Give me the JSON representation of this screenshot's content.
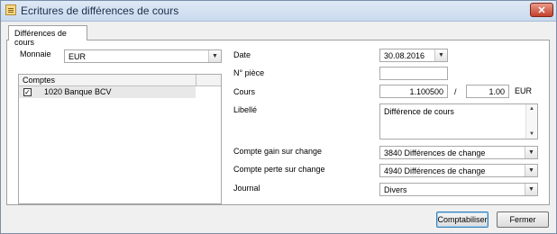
{
  "window": {
    "title": "Ecritures de différences de cours",
    "close_label": "✕"
  },
  "tab": {
    "label": "Différences de cours"
  },
  "monnaie": {
    "label": "Monnaie",
    "value": "EUR"
  },
  "comptes": {
    "header": "Comptes",
    "rows": [
      {
        "checked": true,
        "check_glyph": "✓",
        "label": "1020 Banque BCV"
      }
    ]
  },
  "fields": {
    "date": {
      "label": "Date",
      "value": "30.08.2016"
    },
    "piece": {
      "label": "N° pièce",
      "value": ""
    },
    "cours": {
      "label": "Cours",
      "value": "1.100500",
      "separator": "/",
      "value2": "1.00",
      "unit": "EUR"
    },
    "libelle": {
      "label": "Libellé",
      "value": "Différence de cours"
    },
    "gain": {
      "label": "Compte gain sur change",
      "value": "3840 Différences de change"
    },
    "perte": {
      "label": "Compte perte sur change",
      "value": "4940 Différences de change"
    },
    "journal": {
      "label": "Journal",
      "value": "Divers"
    }
  },
  "buttons": {
    "comptabiliser": "Comptabiliser",
    "fermer": "Fermer"
  },
  "icons": {
    "dropdown": "chevron-down-icon",
    "app": "document-icon"
  }
}
